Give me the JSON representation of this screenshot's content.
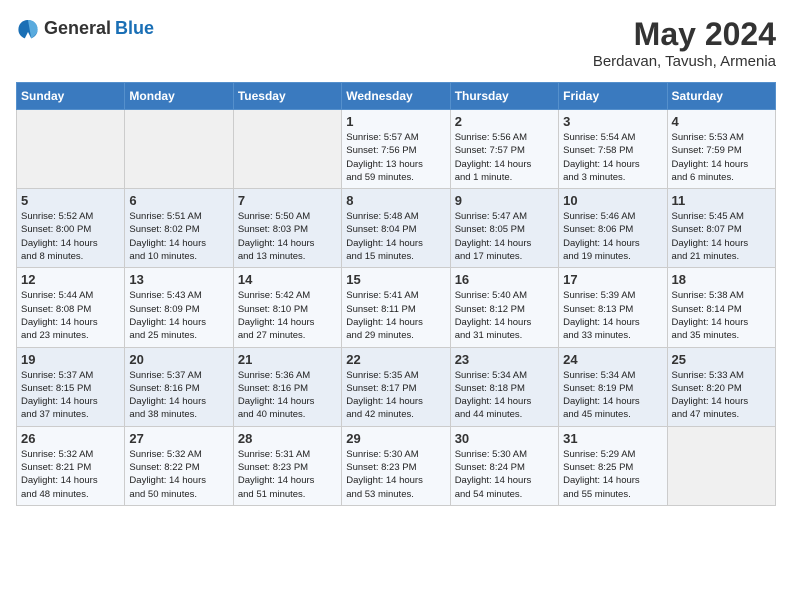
{
  "logo": {
    "general": "General",
    "blue": "Blue"
  },
  "title": "May 2024",
  "location": "Berdavan, Tavush, Armenia",
  "days_of_week": [
    "Sunday",
    "Monday",
    "Tuesday",
    "Wednesday",
    "Thursday",
    "Friday",
    "Saturday"
  ],
  "weeks": [
    [
      {
        "day": "",
        "info": ""
      },
      {
        "day": "",
        "info": ""
      },
      {
        "day": "",
        "info": ""
      },
      {
        "day": "1",
        "info": "Sunrise: 5:57 AM\nSunset: 7:56 PM\nDaylight: 13 hours\nand 59 minutes."
      },
      {
        "day": "2",
        "info": "Sunrise: 5:56 AM\nSunset: 7:57 PM\nDaylight: 14 hours\nand 1 minute."
      },
      {
        "day": "3",
        "info": "Sunrise: 5:54 AM\nSunset: 7:58 PM\nDaylight: 14 hours\nand 3 minutes."
      },
      {
        "day": "4",
        "info": "Sunrise: 5:53 AM\nSunset: 7:59 PM\nDaylight: 14 hours\nand 6 minutes."
      }
    ],
    [
      {
        "day": "5",
        "info": "Sunrise: 5:52 AM\nSunset: 8:00 PM\nDaylight: 14 hours\nand 8 minutes."
      },
      {
        "day": "6",
        "info": "Sunrise: 5:51 AM\nSunset: 8:02 PM\nDaylight: 14 hours\nand 10 minutes."
      },
      {
        "day": "7",
        "info": "Sunrise: 5:50 AM\nSunset: 8:03 PM\nDaylight: 14 hours\nand 13 minutes."
      },
      {
        "day": "8",
        "info": "Sunrise: 5:48 AM\nSunset: 8:04 PM\nDaylight: 14 hours\nand 15 minutes."
      },
      {
        "day": "9",
        "info": "Sunrise: 5:47 AM\nSunset: 8:05 PM\nDaylight: 14 hours\nand 17 minutes."
      },
      {
        "day": "10",
        "info": "Sunrise: 5:46 AM\nSunset: 8:06 PM\nDaylight: 14 hours\nand 19 minutes."
      },
      {
        "day": "11",
        "info": "Sunrise: 5:45 AM\nSunset: 8:07 PM\nDaylight: 14 hours\nand 21 minutes."
      }
    ],
    [
      {
        "day": "12",
        "info": "Sunrise: 5:44 AM\nSunset: 8:08 PM\nDaylight: 14 hours\nand 23 minutes."
      },
      {
        "day": "13",
        "info": "Sunrise: 5:43 AM\nSunset: 8:09 PM\nDaylight: 14 hours\nand 25 minutes."
      },
      {
        "day": "14",
        "info": "Sunrise: 5:42 AM\nSunset: 8:10 PM\nDaylight: 14 hours\nand 27 minutes."
      },
      {
        "day": "15",
        "info": "Sunrise: 5:41 AM\nSunset: 8:11 PM\nDaylight: 14 hours\nand 29 minutes."
      },
      {
        "day": "16",
        "info": "Sunrise: 5:40 AM\nSunset: 8:12 PM\nDaylight: 14 hours\nand 31 minutes."
      },
      {
        "day": "17",
        "info": "Sunrise: 5:39 AM\nSunset: 8:13 PM\nDaylight: 14 hours\nand 33 minutes."
      },
      {
        "day": "18",
        "info": "Sunrise: 5:38 AM\nSunset: 8:14 PM\nDaylight: 14 hours\nand 35 minutes."
      }
    ],
    [
      {
        "day": "19",
        "info": "Sunrise: 5:37 AM\nSunset: 8:15 PM\nDaylight: 14 hours\nand 37 minutes."
      },
      {
        "day": "20",
        "info": "Sunrise: 5:37 AM\nSunset: 8:16 PM\nDaylight: 14 hours\nand 38 minutes."
      },
      {
        "day": "21",
        "info": "Sunrise: 5:36 AM\nSunset: 8:16 PM\nDaylight: 14 hours\nand 40 minutes."
      },
      {
        "day": "22",
        "info": "Sunrise: 5:35 AM\nSunset: 8:17 PM\nDaylight: 14 hours\nand 42 minutes."
      },
      {
        "day": "23",
        "info": "Sunrise: 5:34 AM\nSunset: 8:18 PM\nDaylight: 14 hours\nand 44 minutes."
      },
      {
        "day": "24",
        "info": "Sunrise: 5:34 AM\nSunset: 8:19 PM\nDaylight: 14 hours\nand 45 minutes."
      },
      {
        "day": "25",
        "info": "Sunrise: 5:33 AM\nSunset: 8:20 PM\nDaylight: 14 hours\nand 47 minutes."
      }
    ],
    [
      {
        "day": "26",
        "info": "Sunrise: 5:32 AM\nSunset: 8:21 PM\nDaylight: 14 hours\nand 48 minutes."
      },
      {
        "day": "27",
        "info": "Sunrise: 5:32 AM\nSunset: 8:22 PM\nDaylight: 14 hours\nand 50 minutes."
      },
      {
        "day": "28",
        "info": "Sunrise: 5:31 AM\nSunset: 8:23 PM\nDaylight: 14 hours\nand 51 minutes."
      },
      {
        "day": "29",
        "info": "Sunrise: 5:30 AM\nSunset: 8:23 PM\nDaylight: 14 hours\nand 53 minutes."
      },
      {
        "day": "30",
        "info": "Sunrise: 5:30 AM\nSunset: 8:24 PM\nDaylight: 14 hours\nand 54 minutes."
      },
      {
        "day": "31",
        "info": "Sunrise: 5:29 AM\nSunset: 8:25 PM\nDaylight: 14 hours\nand 55 minutes."
      },
      {
        "day": "",
        "info": ""
      }
    ]
  ]
}
